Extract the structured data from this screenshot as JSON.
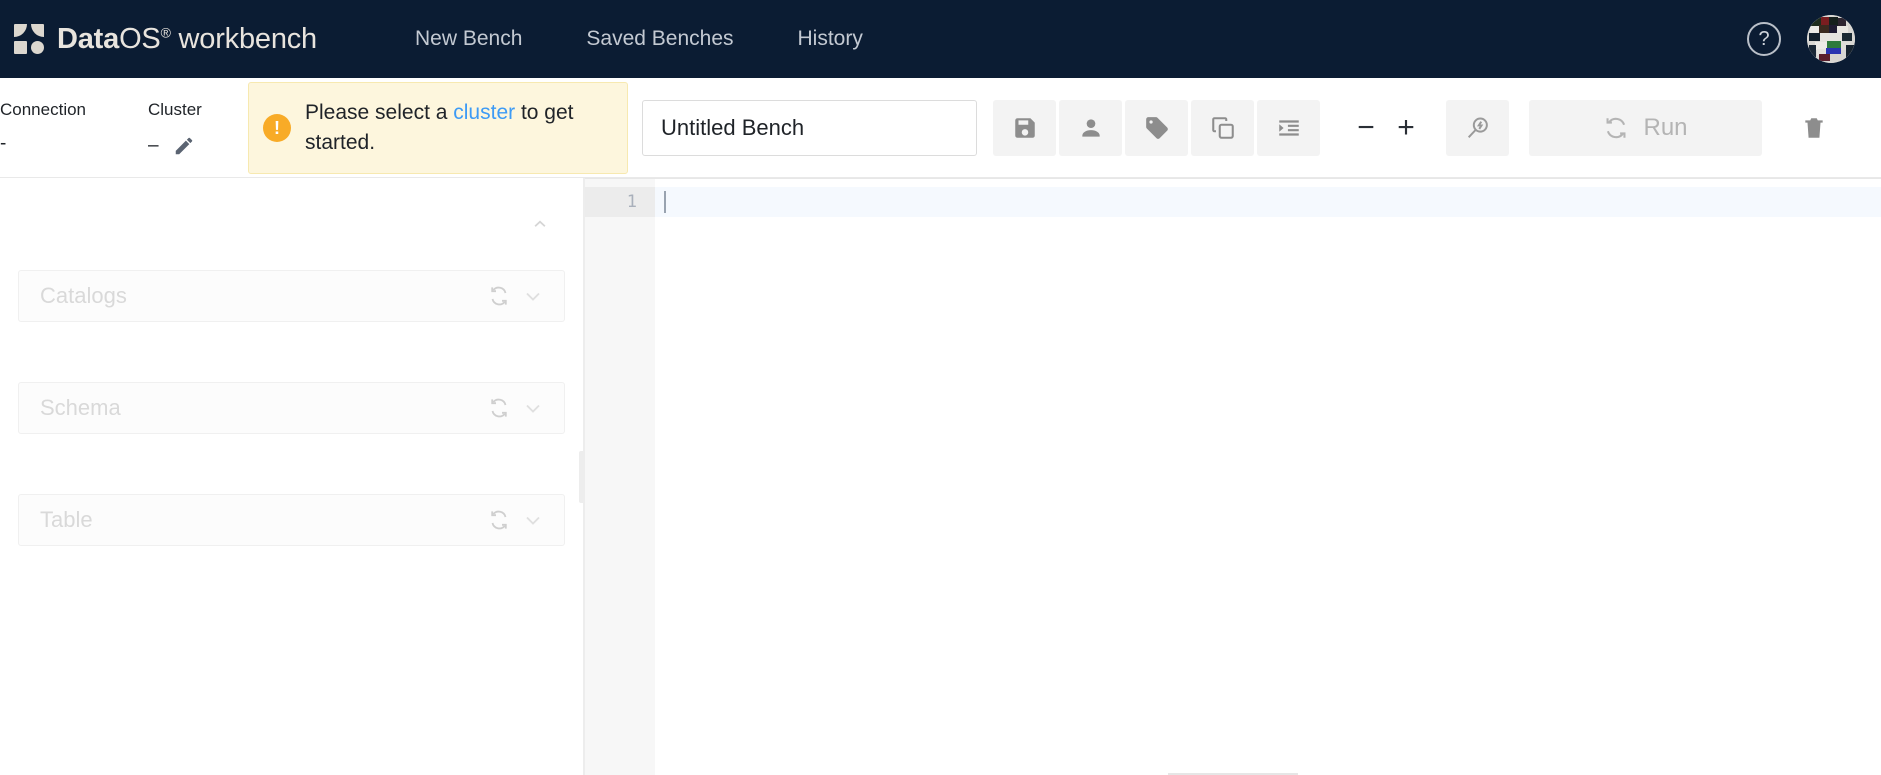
{
  "app": {
    "brand_strong": "Data",
    "brand_light": "OS",
    "brand_sup": "®",
    "brand_suffix": "workbench",
    "logo_icon": "dataos-logo-icon"
  },
  "nav": {
    "items": [
      {
        "label": "New Bench",
        "name": "nav-new-bench"
      },
      {
        "label": "Saved Benches",
        "name": "nav-saved-benches"
      },
      {
        "label": "History",
        "name": "nav-history"
      }
    ],
    "help_icon": "question-mark-icon",
    "help_label": "?",
    "avatar_icon": "user-avatar-icon"
  },
  "toolbar": {
    "connection_label": "Connection",
    "connection_value": "-",
    "cluster_label": "Cluster",
    "cluster_value": "–",
    "edit_cluster_icon": "pencil-icon",
    "alert": {
      "icon": "warning-exclamation-icon",
      "icon_glyph": "!",
      "text_before": "Please select a ",
      "link": "cluster",
      "text_after": " to get started."
    },
    "bench_title_value": "Untitled Bench",
    "bench_title_placeholder": "Untitled Bench",
    "actions": [
      {
        "name": "save-button",
        "icon": "save-floppy-icon",
        "title": "Save"
      },
      {
        "name": "share-user-button",
        "icon": "person-icon",
        "title": "Share"
      },
      {
        "name": "tag-button",
        "icon": "tag-icon",
        "title": "Tags"
      },
      {
        "name": "copy-button",
        "icon": "copy-icon",
        "title": "Copy"
      },
      {
        "name": "format-indent-button",
        "icon": "format-indent-icon",
        "title": "Format"
      }
    ],
    "zoom_out_label": "−",
    "zoom_in_label": "+",
    "query-explain_icon": "magnifier-bolt-icon",
    "run_label": "Run",
    "run_icon": "refresh-icon",
    "delete_icon": "trash-icon"
  },
  "sidebar": {
    "collapse_icon": "chevron-up-icon",
    "selects": [
      {
        "name": "catalogs-select",
        "placeholder": "Catalogs",
        "refresh_icon": "refresh-icon",
        "chevron_icon": "chevron-down-icon"
      },
      {
        "name": "schema-select",
        "placeholder": "Schema",
        "refresh_icon": "refresh-icon",
        "chevron_icon": "chevron-down-icon"
      },
      {
        "name": "table-select",
        "placeholder": "Table",
        "refresh_icon": "refresh-icon",
        "chevron_icon": "chevron-down-icon"
      }
    ]
  },
  "editor": {
    "line_numbers": [
      "1"
    ],
    "content": ""
  },
  "colors": {
    "topbar_bg": "#0b1c33",
    "brand_text": "#e8e4de",
    "nav_text": "#c3c9d2",
    "alert_bg": "#fdf6dd",
    "alert_border": "#f7e9b0",
    "alert_icon": "#f8ab27",
    "link": "#3d9bf5",
    "active_line": "#f5f9fe",
    "gutter_bg": "#f7f7f7"
  }
}
